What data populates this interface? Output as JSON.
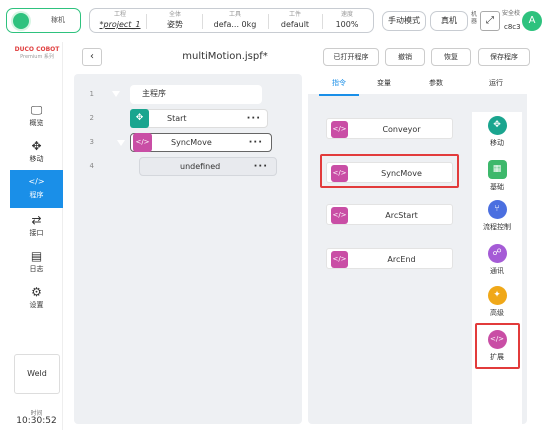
{
  "topbar": {
    "power_label": "稼机",
    "status": [
      {
        "key": "工程",
        "value": "*project_1"
      },
      {
        "key": "全体",
        "value": "姿势"
      },
      {
        "key": "工具",
        "value": "defa... 0kg"
      },
      {
        "key": "工件",
        "value": "default"
      },
      {
        "key": "速度",
        "value": "100%"
      }
    ],
    "manual_mode": "手动模式",
    "real_machine": "真机",
    "side_tiny_1": "机器",
    "side_tiny_2": "实",
    "safety_label": "安全校",
    "safety_code": "c8c3",
    "avatar_letter": "A"
  },
  "sidebar": {
    "logo_line1": "DUCO COBOT",
    "logo_line2": "Premium 系列",
    "items": [
      {
        "label": "概览",
        "icon": "monitor-icon",
        "glyph": "🖵"
      },
      {
        "label": "移动",
        "icon": "move-icon",
        "glyph": "✥"
      },
      {
        "label": "程序",
        "icon": "code-icon",
        "glyph": "</>"
      },
      {
        "label": "接口",
        "icon": "swap-icon",
        "glyph": "⇄"
      },
      {
        "label": "日志",
        "icon": "calendar-icon",
        "glyph": "▤"
      },
      {
        "label": "设置",
        "icon": "gear-icon",
        "glyph": "⚙"
      }
    ],
    "weld_label": "Weld",
    "time_key": "时间",
    "time_value": "10:30:52"
  },
  "header": {
    "back_glyph": "‹",
    "file_title": "multiMotion.jspf*",
    "open_program": "已打开程序",
    "undo": "撤销",
    "redo": "恢复",
    "save_program": "保存程序"
  },
  "program_tree": {
    "root_label": "主程序",
    "lines": [
      {
        "no": "1"
      },
      {
        "no": "2",
        "label": "Start"
      },
      {
        "no": "3",
        "label": "SyncMove"
      },
      {
        "no": "4",
        "label": "undefined"
      }
    ]
  },
  "right_panel": {
    "tabs": [
      "指令",
      "变量",
      "参数",
      "运行"
    ],
    "active_tab": "指令",
    "commands": [
      "Conveyor",
      "SyncMove",
      "ArcStart",
      "ArcEnd"
    ],
    "categories": [
      {
        "label": "移动",
        "color": "#1aa58f",
        "glyph": "✥"
      },
      {
        "label": "基础",
        "color": "#3db86b",
        "glyph": "▦"
      },
      {
        "label": "流程控制",
        "color": "#4b6fe0",
        "glyph": "⑂"
      },
      {
        "label": "通讯",
        "color": "#a55bd6",
        "glyph": "☍"
      },
      {
        "label": "高级",
        "color": "#f0a818",
        "glyph": "✦"
      },
      {
        "label": "扩展",
        "color": "#c94ea5",
        "glyph": "</>"
      }
    ]
  },
  "colors": {
    "accent": "#1a8fe8",
    "extension": "#c94ea5",
    "move": "#1aa58f",
    "highlight": "#e23b3b"
  }
}
